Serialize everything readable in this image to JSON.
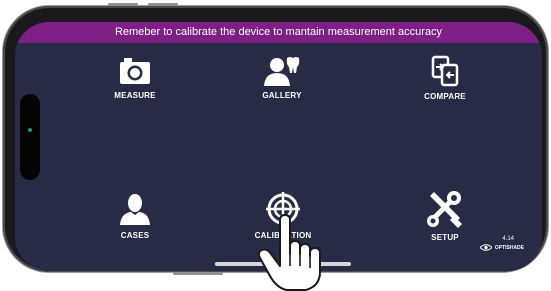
{
  "banner": {
    "text": "Remeber to calibrate the device to mantain measurement accuracy"
  },
  "menu": {
    "measure": {
      "label": "MEASURE",
      "icon": "camera-icon"
    },
    "gallery": {
      "label": "GALLERY",
      "icon": "patient-tooth-icon"
    },
    "compare": {
      "label": "COMPARE",
      "icon": "compare-icon"
    },
    "cases": {
      "label": "CASES",
      "icon": "person-icon"
    },
    "calibration": {
      "label": "CALIBRATION",
      "icon": "crosshair-icon"
    },
    "setup": {
      "label": "SETUP",
      "icon": "tools-icon"
    }
  },
  "footer": {
    "version": "4.14",
    "brand": "OPTISHADE",
    "brand_icon": "eye-icon"
  },
  "colors": {
    "banner": "#7e1f86",
    "screen_background": "#282b45",
    "text": "#ffffff"
  },
  "overlay": {
    "icon": "tap-hand-icon"
  }
}
